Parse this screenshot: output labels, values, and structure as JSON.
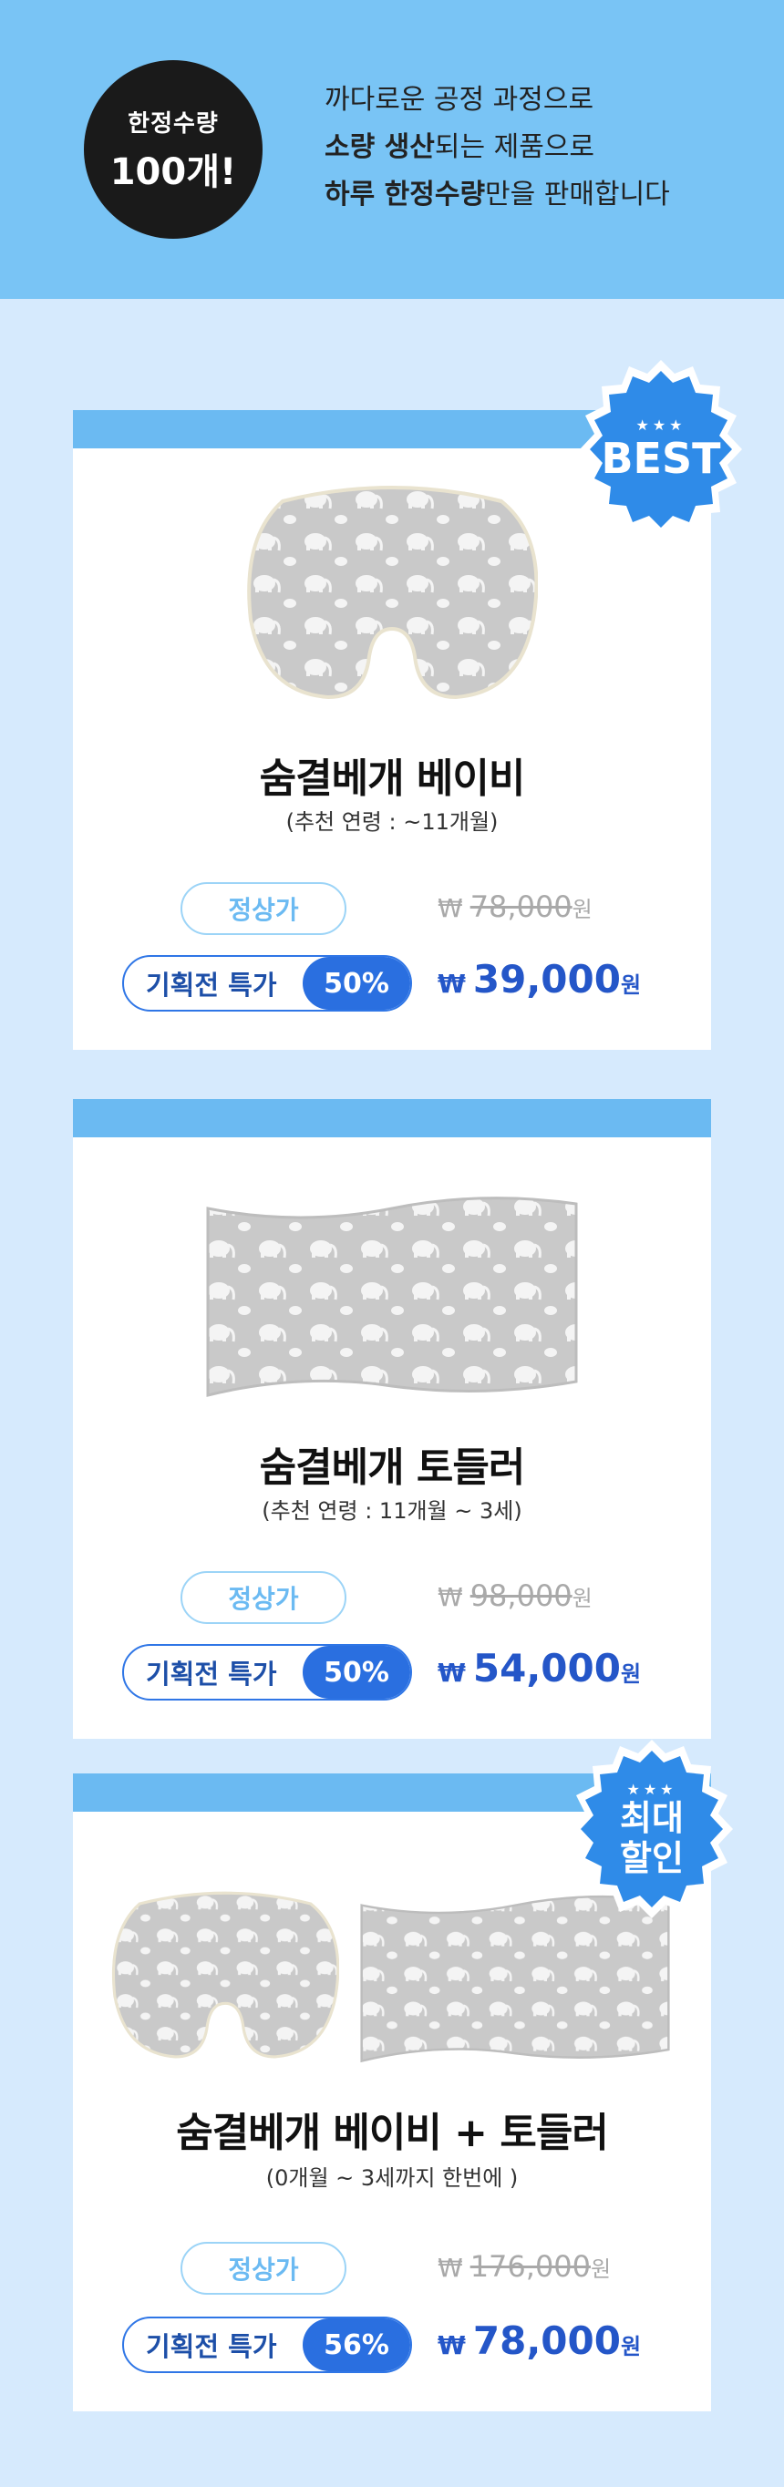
{
  "header": {
    "badge_line1": "한정수량",
    "badge_line2": "100개!",
    "line1": "까다로운 공정 과정으로",
    "line2_bold": "소량 생산",
    "line2_rest": "되는 제품으로",
    "line3_bold": "하루 한정수량",
    "line3_rest": "만을 판매합니다"
  },
  "colors": {
    "accent": "#2a6fe0",
    "bar": "#6bbaf2",
    "background": "#d6eafd"
  },
  "products": [
    {
      "badge": "BEST",
      "badge_stars": "★★★",
      "title": "숨결베개 베이비",
      "subtitle": "(추천 연령 : ~11개월)",
      "regular_label": "정상가",
      "regular_price": "78,000",
      "special_label": "기획전 특가",
      "discount": "50%",
      "sale_price": "39,000",
      "currency": "₩",
      "won": "원"
    },
    {
      "title": "숨결베개 토들러",
      "subtitle": "(추천 연령 : 11개월 ~ 3세)",
      "regular_label": "정상가",
      "regular_price": "98,000",
      "special_label": "기획전 특가",
      "discount": "50%",
      "sale_price": "54,000",
      "currency": "₩",
      "won": "원"
    },
    {
      "badge_line1": "최대",
      "badge_line2": "할인",
      "badge_stars": "★★★",
      "title": "숨결베개 베이비 + 토들러",
      "subtitle": "(0개월 ~ 3세까지 한번에 )",
      "regular_label": "정상가",
      "regular_price": "176,000",
      "special_label": "기획전 특가",
      "discount": "56%",
      "sale_price": "78,000",
      "currency": "₩",
      "won": "원"
    }
  ]
}
